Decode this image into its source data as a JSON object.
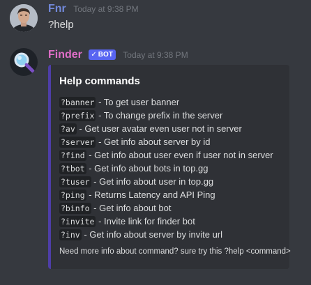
{
  "messages": [
    {
      "author": "Fnr",
      "author_color": "#7289da",
      "timestamp": "Today at 9:38 PM",
      "content": "?help",
      "avatar_icon": "user-photo-avatar"
    },
    {
      "author": "Finder",
      "author_color": "#e06ec8",
      "timestamp": "Today at 9:38 PM",
      "bot_tag": {
        "check": "✓",
        "label": "BOT"
      },
      "avatar_icon": "magnifier-avatar",
      "embed": {
        "accent_color": "#4e3ea8",
        "title": "Help commands",
        "commands": [
          {
            "command": "?banner",
            "description": " - To get user banner"
          },
          {
            "command": "?prefix",
            "description": " - To change prefix in the server"
          },
          {
            "command": "?av",
            "description": " - Get user avatar even user not in server"
          },
          {
            "command": "?server",
            "description": " - Get info about server by id"
          },
          {
            "command": "?find",
            "description": " - Get info about user even if user not in server"
          },
          {
            "command": "?tbot",
            "description": " - Get info about bots in top.gg"
          },
          {
            "command": "?tuser",
            "description": " - Get info about user in top.gg"
          },
          {
            "command": "?ping",
            "description": " - Returns Latency and API Ping"
          },
          {
            "command": "?binfo",
            "description": " - Get info about bot"
          },
          {
            "command": "?invite",
            "description": " - Invite link for finder bot"
          },
          {
            "command": "?inv",
            "description": " - Get info about server by invite url"
          }
        ],
        "footer": "Need more info about command? sure try this ?help <command>"
      }
    }
  ]
}
